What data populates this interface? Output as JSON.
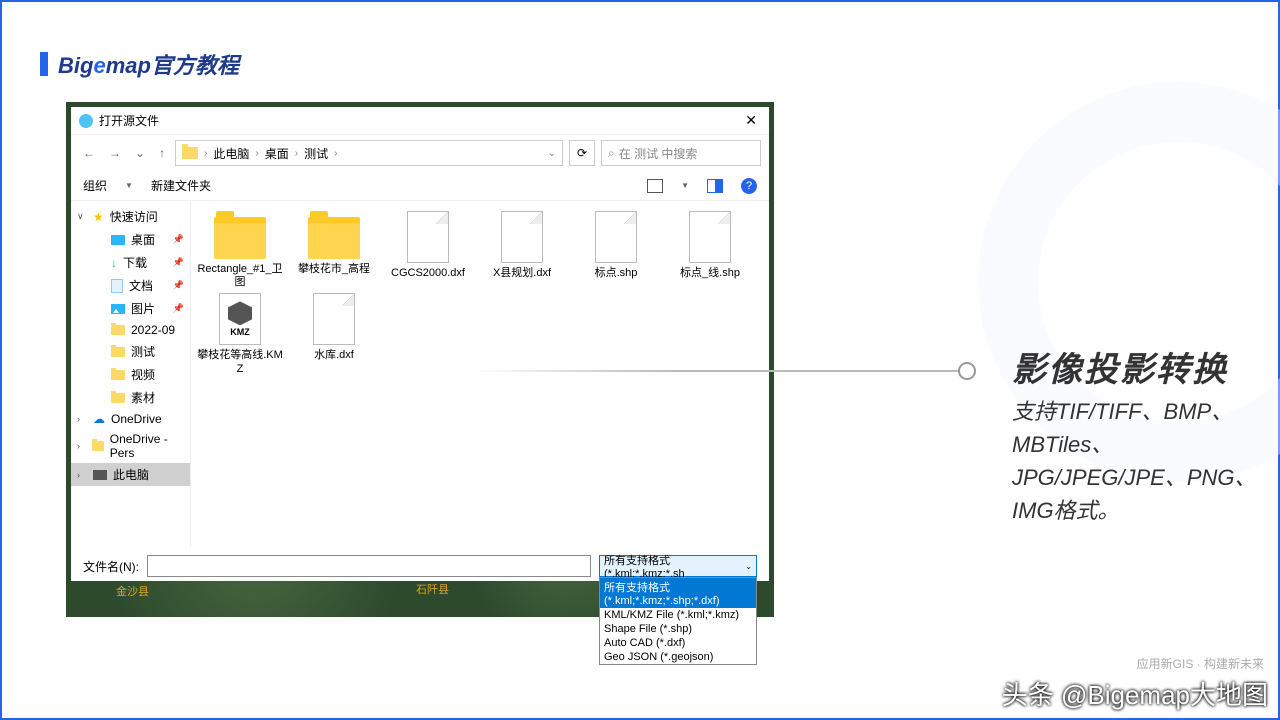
{
  "header": {
    "brand_pre": "Big",
    "brand_e": "e",
    "brand_post": "map",
    "suffix": "官方教程"
  },
  "dialog": {
    "title": "打开源文件",
    "breadcrumb": [
      "此电脑",
      "桌面",
      "测试"
    ],
    "search_placeholder": "在 测试 中搜索",
    "toolbar": {
      "organize": "组织",
      "newfolder": "新建文件夹"
    },
    "filename_label": "文件名(N):",
    "filetype_selected": "所有支持格式(*.kml;*.kmz;*.sh",
    "filetype_options": [
      "所有支持格式(*.kml;*.kmz;*.shp;*.dxf)",
      "KML/KMZ File (*.kml;*.kmz)",
      "Shape File (*.shp)",
      "Auto CAD (*.dxf)",
      "Geo JSON (*.geojson)"
    ]
  },
  "sidebar": [
    {
      "label": "快速访问",
      "icon": "star",
      "chev": "∨"
    },
    {
      "label": "桌面",
      "icon": "blue",
      "pin": true,
      "indent": true
    },
    {
      "label": "下载",
      "icon": "green",
      "pin": true,
      "indent": true
    },
    {
      "label": "文档",
      "icon": "doc",
      "pin": true,
      "indent": true
    },
    {
      "label": "图片",
      "icon": "pic",
      "pin": true,
      "indent": true
    },
    {
      "label": "2022-09",
      "icon": "folder",
      "indent": true
    },
    {
      "label": "测试",
      "icon": "folder",
      "indent": true
    },
    {
      "label": "视频",
      "icon": "folder",
      "indent": true
    },
    {
      "label": "素材",
      "icon": "folder",
      "indent": true
    },
    {
      "label": "OneDrive",
      "icon": "cloud",
      "chev": "›"
    },
    {
      "label": "OneDrive - Pers",
      "icon": "folder",
      "chev": "›"
    },
    {
      "label": "此电脑",
      "icon": "pc",
      "chev": "›",
      "sel": true
    }
  ],
  "files": [
    {
      "name": "Rectangle_#1_卫图",
      "type": "folder"
    },
    {
      "name": "攀枝花市_高程",
      "type": "folder"
    },
    {
      "name": "CGCS2000.dxf",
      "type": "doc"
    },
    {
      "name": "X县规划.dxf",
      "type": "doc"
    },
    {
      "name": "标点.shp",
      "type": "doc"
    },
    {
      "name": "标点_线.shp",
      "type": "doc"
    },
    {
      "name": "攀枝花等高线.KMZ",
      "type": "kmz"
    },
    {
      "name": "水库.dxf",
      "type": "doc"
    }
  ],
  "map_labels": {
    "l1": "金沙县",
    "l2": "石阡县"
  },
  "annotation": {
    "title": "影像投影转换",
    "body": "支持TIF/TIFF、BMP、MBTiles、JPG/JPEG/JPE、PNG、IMG格式。"
  },
  "footer_tag": "应用新GIS · 构建新未来",
  "watermark": "头条 @Bigemap大地图",
  "kmz_tag": "KMZ"
}
